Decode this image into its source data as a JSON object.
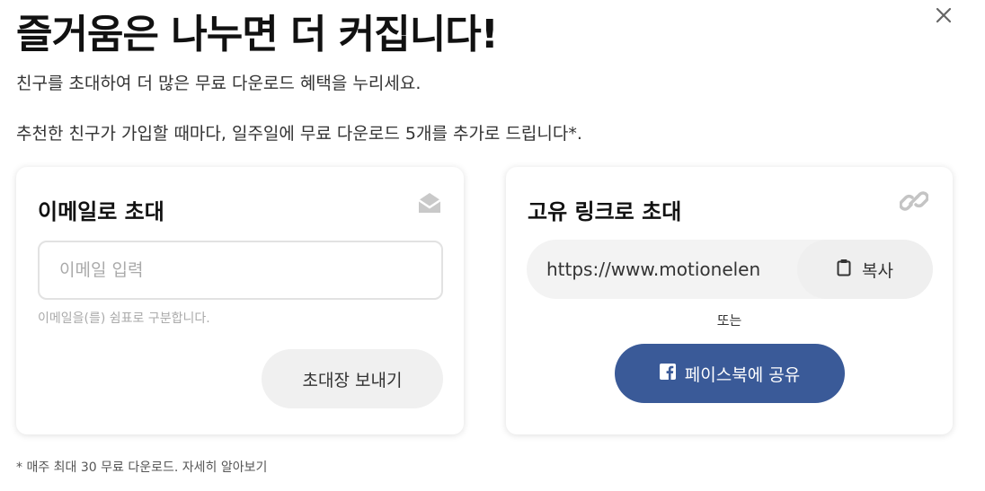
{
  "header": {
    "title": "즐거움은 나누면 더 커집니다!",
    "subtitle": "친구를 초대하여 더 많은 무료 다운로드 혜택을 누리세요.",
    "description": "추천한 친구가 가입할 때마다, 일주일에 무료 다운로드 5개를 추가로 드립니다*.",
    "close_icon": "close-icon"
  },
  "email_card": {
    "title": "이메일로 초대",
    "icon": "envelope-icon",
    "input_placeholder": "이메일 입력",
    "input_value": "",
    "hint": "이메일을(를) 쉼표로 구분합니다.",
    "send_label": "초대장 보내기"
  },
  "link_card": {
    "title": "고유 링크로 초대",
    "icon": "link-icon",
    "link_value": "https://www.motionelen",
    "copy_label": "복사",
    "copy_icon": "clipboard-icon",
    "or_label": "또는",
    "facebook_label": "페이스북에 공유",
    "facebook_icon": "facebook-icon",
    "facebook_color": "#3a5a98"
  },
  "footer": {
    "footnote": "* 매주 최대 30 무료 다운로드. 자세히 알아보기"
  }
}
